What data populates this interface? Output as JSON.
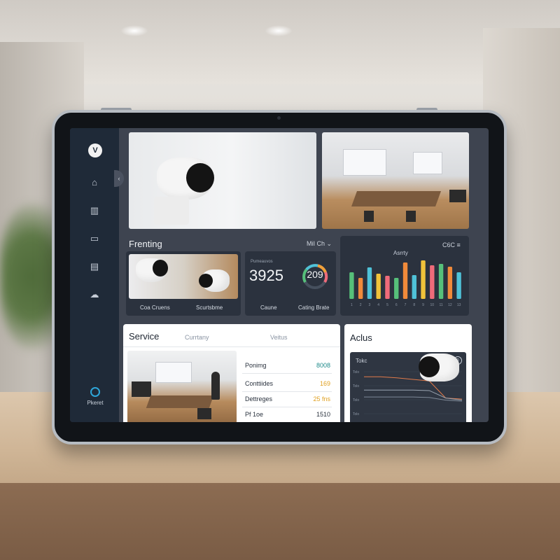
{
  "sidebar": {
    "logo_text": "V",
    "icons": [
      "home-icon",
      "building-icon",
      "folder-icon",
      "calendar-icon",
      "cloud-icon"
    ],
    "profile_label": "Pkeret"
  },
  "frenting": {
    "title": "Frenting",
    "select_label": "MiI Ch",
    "captions": [
      "Coa Cruens",
      "Scurtsbme"
    ],
    "stat_tiny": "Pumeauvos",
    "stat_value": "3925",
    "gauge_value": "209",
    "stat_captions": [
      "Caune",
      "Cating Brate"
    ]
  },
  "activity": {
    "title": "Asrrty",
    "select_label": "C6C",
    "colors": [
      "#56c07a",
      "#f08a3a",
      "#4fc2d8",
      "#f0c23a",
      "#ef6b7a"
    ]
  },
  "chart_data": [
    {
      "type": "bar",
      "title": "Asrrty",
      "categories": [
        "1",
        "2",
        "3",
        "4",
        "5",
        "6",
        "7",
        "8",
        "9",
        "10",
        "11",
        "12",
        "13"
      ],
      "values": [
        38,
        30,
        45,
        36,
        33,
        30,
        52,
        34,
        55,
        48,
        50,
        46,
        38
      ],
      "xlabel": "",
      "ylabel": "",
      "ylim": [
        0,
        60
      ],
      "grid": false
    },
    {
      "type": "line",
      "title": "Tokc",
      "x": [
        0,
        1,
        2,
        3,
        4,
        5,
        6
      ],
      "series": [
        {
          "values": [
            80,
            80,
            78,
            75,
            72,
            40,
            38
          ]
        },
        {
          "values": [
            55,
            55,
            55,
            55,
            54,
            40,
            36
          ]
        },
        {
          "values": [
            42,
            42,
            42,
            42,
            41,
            36,
            34
          ]
        }
      ],
      "ylabels": [
        "Tolo",
        "Tolo",
        "Tolo",
        "Tolo"
      ]
    }
  ],
  "service": {
    "title": "Service",
    "tabs": [
      "Currtany",
      "Veitus"
    ],
    "rows": [
      {
        "label": "Ponimg",
        "value": "8008",
        "color": "#1f8a8a"
      },
      {
        "label": "Conttiides",
        "value": "169",
        "color": "#e0a020"
      },
      {
        "label": "Dettreges",
        "value": "25 fns",
        "color": "#e0a020"
      },
      {
        "label": "Pf 1oe",
        "value": "1510",
        "color": "#2a323e"
      }
    ]
  },
  "actus": {
    "title": "Aclus",
    "chart_title": "Tokc"
  }
}
